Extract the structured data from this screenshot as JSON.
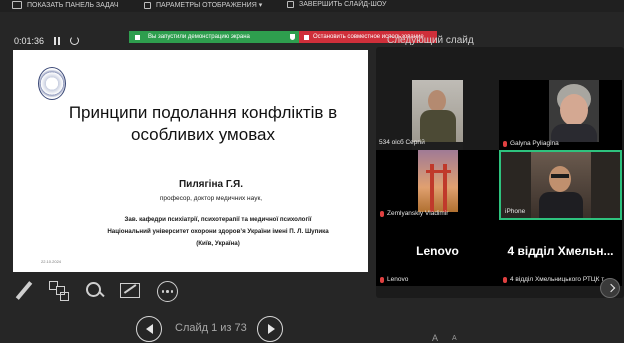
{
  "toolbar": {
    "show_taskbar": "ПОКАЗАТЬ ПАНЕЛЬ ЗАДАЧ",
    "display_settings": "ПАРАМЕТРЫ ОТОБРАЖЕНИЯ ▾",
    "end_show": "ЗАВЕРШИТЬ СЛАЙД-ШОУ"
  },
  "presenter": {
    "timer": "0:01:36",
    "next_slide_label": "Следующий слайд"
  },
  "zoom_notice": {
    "sharing_text": "Вы запустили демонстрацию экрана",
    "stop_text": "Остановить совместное использование",
    "colors": {
      "green": "#2e9e4e",
      "red": "#cf2f3a"
    }
  },
  "slide": {
    "title": "Принципи подолання конфліктів в особливих умовах",
    "author": "Пилягіна Г.Я.",
    "author_position": "професор, доктор медичних наук,",
    "affiliation_line1": "Зав. кафедри психіатрії, психотерапії та медичної психології",
    "affiliation_line2": "Національний університет охорони здоров’я України імені П. Л. Шупика",
    "affiliation_line3": "(Київ, Україна)",
    "date": "22.10.2024"
  },
  "navigation": {
    "slide_counter": "Слайд 1 из 73"
  },
  "participants": [
    {
      "name": "534 оісб Сергій"
    },
    {
      "name": "Galyna Pyliagina"
    },
    {
      "name": "Zemlyanskiy Vladimir"
    },
    {
      "name": "iPhone"
    },
    {
      "name": "Lenovo",
      "display": "Lenovo"
    },
    {
      "name": "4 відділ Хмельницького РТЦК т...",
      "display": "4 відділ Хмельн..."
    }
  ],
  "font_controls": {
    "increase": "A",
    "decrease": "A"
  }
}
